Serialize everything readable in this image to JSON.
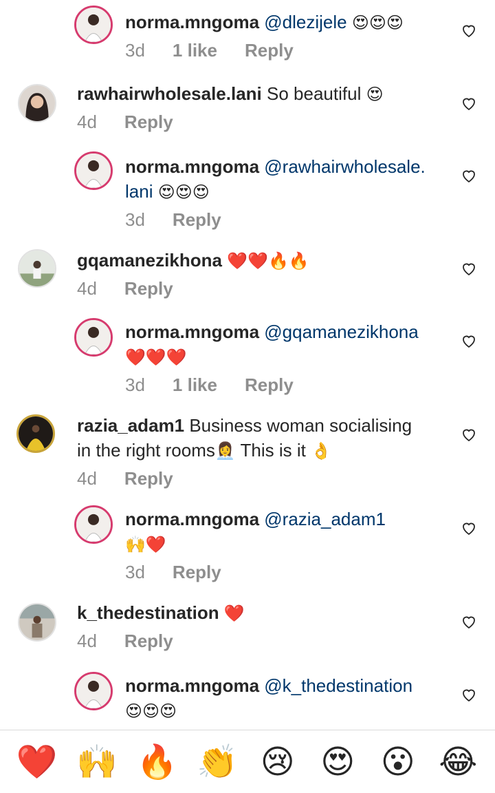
{
  "comments": [
    {
      "user": "norma.mngoma",
      "mention": "@dlezijele",
      "text": "",
      "emoji": "😍😍😍",
      "time": "3d",
      "likes": "1 like",
      "reply": "Reply",
      "is_reply": true
    },
    {
      "user": "rawhairwholesale.lani",
      "mention": "",
      "text": "So beautiful",
      "emoji": "😍",
      "time": "4d",
      "likes": "",
      "reply": "Reply",
      "is_reply": false
    },
    {
      "user": "norma.mngoma",
      "mention": "@rawhairwholesale.",
      "mention2": "lani",
      "emoji": "😍😍😍",
      "time": "3d",
      "likes": "",
      "reply": "Reply",
      "is_reply": true
    },
    {
      "user": "gqamanezikhona",
      "mention": "",
      "text": "",
      "emoji": "❤️❤️🔥🔥",
      "time": "4d",
      "likes": "",
      "reply": "Reply",
      "is_reply": false
    },
    {
      "user": "norma.mngoma",
      "mention": "@gqamanezikhona",
      "emoji": "❤️❤️❤️",
      "time": "3d",
      "likes": "1 like",
      "reply": "Reply",
      "is_reply": true
    },
    {
      "user": "razia_adam1",
      "text": "Business woman socialising",
      "text2": "in the right rooms",
      "emoji": "👩‍💼",
      "text3": "This is it",
      "emoji2": "👌",
      "time": "4d",
      "likes": "",
      "reply": "Reply",
      "is_reply": false
    },
    {
      "user": "norma.mngoma",
      "mention": "@razia_adam1",
      "emoji": "🙌❤️",
      "time": "3d",
      "likes": "",
      "reply": "Reply",
      "is_reply": true
    },
    {
      "user": "k_thedestination",
      "text": "",
      "emoji": "❤️",
      "time": "4d",
      "likes": "",
      "reply": "Reply",
      "is_reply": false
    },
    {
      "user": "norma.mngoma",
      "mention": "@k_thedestination",
      "emoji": "😍😍😍",
      "time": "",
      "likes": "",
      "reply": "",
      "is_reply": true
    }
  ],
  "reaction_bar": [
    "❤️",
    "🙌",
    "🔥",
    "👏",
    "😢",
    "😍",
    "😮",
    "😂"
  ],
  "colors": {
    "mention": "#00376b",
    "meta": "#8e8e8e",
    "ring": "#d63b6e"
  }
}
